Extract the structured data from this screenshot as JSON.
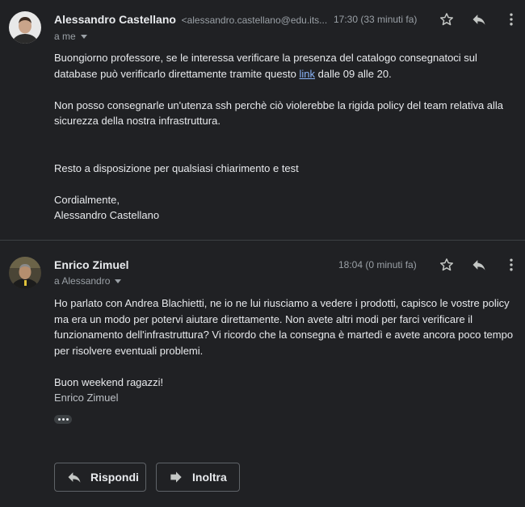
{
  "messages": [
    {
      "sender_name": "Alessandro Castellano",
      "sender_email": "<alessandro.castellano@edu.its...",
      "time": "17:30 (33 minuti fa)",
      "recipient": "a me",
      "body": {
        "p1_before": "Buongiorno professore, se le interessa verificare la presenza del catalogo consegnatoci sul database può verificarlo direttamente tramite questo ",
        "p1_link": "link",
        "p1_after": " dalle 09 alle 20.",
        "p2": "Non posso consegnarle un'utenza ssh perchè ciò violerebbe la rigida policy del team relativa alla sicurezza della nostra infrastruttura.",
        "p3": "Resto a disposizione per qualsiasi chiarimento e test",
        "closing": "Cordialmente,",
        "signature": "Alessandro Castellano"
      }
    },
    {
      "sender_name": "Enrico Zimuel",
      "time": "18:04 (0 minuti fa)",
      "recipient": "a Alessandro",
      "body": {
        "p1": "Ho parlato con Andrea Blachietti, ne io ne lui riusciamo a vedere i prodotti, capisco le vostre policy ma era un modo per potervi aiutare direttamente. Non avete altri modi per farci verificare il funzionamento dell'infrastruttura? Vi ricordo che la consegna è martedì e avete ancora poco tempo per risolvere eventuali problemi.",
        "p2": "Buon weekend ragazzi!",
        "signature": "Enrico Zimuel"
      }
    }
  ],
  "actions": {
    "reply_label": "Rispondi",
    "forward_label": "Inoltra"
  },
  "icons": [
    "star-icon",
    "reply-icon",
    "more-vert-icon",
    "chevron-down-icon",
    "forward-icon"
  ],
  "colors": {
    "background": "#202124",
    "text": "#e8eaed",
    "muted": "#9aa0a6",
    "link": "#8ab4f8"
  }
}
